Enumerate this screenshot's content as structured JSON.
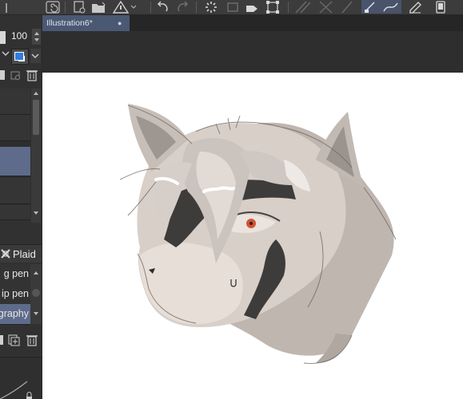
{
  "left_panel": {
    "opacity_value": "100",
    "subtool_group_label": "Plaid",
    "brushes": [
      {
        "label": "g pen"
      },
      {
        "label": "ip pen"
      },
      {
        "label": "graphy"
      }
    ]
  },
  "document": {
    "tab_title": "Illustration6*",
    "tab_close": "●"
  },
  "colors": {
    "main_color": "#2f7de1",
    "sub_color": "#ffffff",
    "selected_row": "#5e6b8a",
    "tab_active": "#4b5874"
  },
  "icons": [
    "spiral-icon",
    "new-file-icon",
    "open-folder-icon",
    "warning-icon",
    "undo-icon",
    "redo-icon",
    "loading-icon",
    "transform-icon",
    "fill-icon",
    "selection-icon",
    "ruler-icon",
    "pen-pressure-icon",
    "edit-icon",
    "device-icon",
    "lock-icon",
    "trash-icon",
    "add-layer-icon",
    "folder-icon"
  ]
}
